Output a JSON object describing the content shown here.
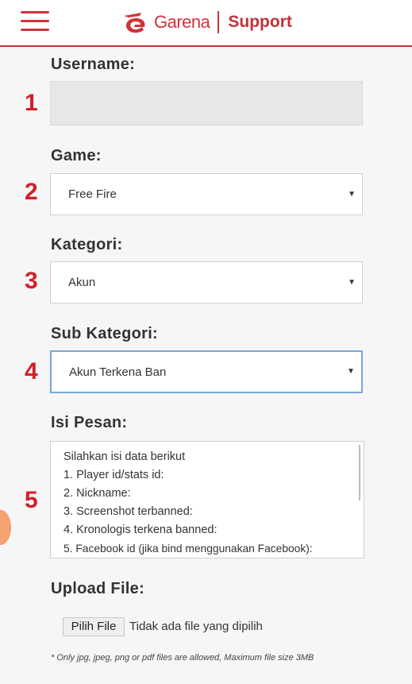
{
  "header": {
    "brand_name": "Garena",
    "section_name": "Support",
    "menu_icon": "hamburger-menu-icon",
    "logo_icon": "garena-logo-icon",
    "brand_color": "#d1333b"
  },
  "form": {
    "username": {
      "label": "Username:",
      "number": "1",
      "value": ""
    },
    "game": {
      "label": "Game:",
      "number": "2",
      "selected": "Free Fire"
    },
    "kategori": {
      "label": "Kategori:",
      "number": "3",
      "selected": "Akun"
    },
    "sub_kategori": {
      "label": "Sub Kategori:",
      "number": "4",
      "selected": "Akun Terkena Ban"
    },
    "isi_pesan": {
      "label": "Isi Pesan:",
      "number": "5",
      "lines": [
        "Silahkan isi data berikut",
        "1. Player id/stats id:",
        "2. Nickname:",
        "3. Screenshot terbanned:",
        "4. Kronologis terkena banned:",
        "5. Facebook id (jika bind menggunakan Facebook):"
      ]
    },
    "upload": {
      "label": "Upload File:",
      "button_label": "Pilih File",
      "status": "Tidak ada file yang dipilih",
      "note": "* Only jpg, jpeg, png or pdf files are allowed, Maximum file size 3MB"
    }
  },
  "annotation_color": "#d2202a"
}
